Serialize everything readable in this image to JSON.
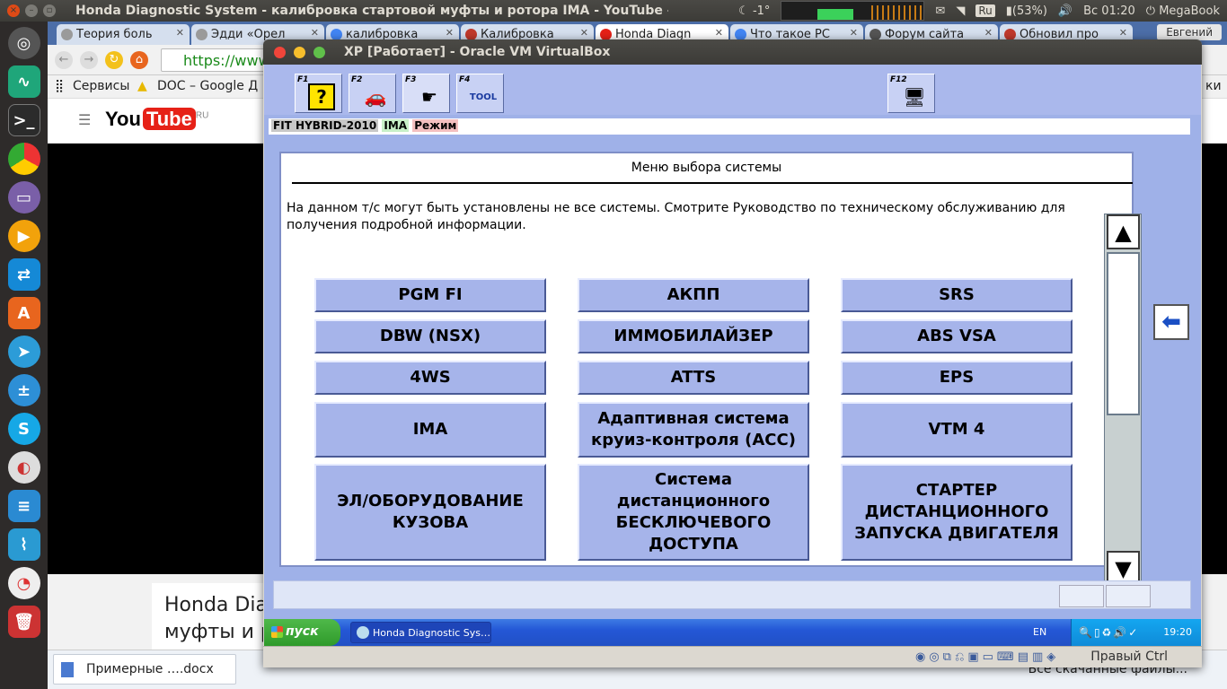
{
  "top_panel": {
    "title": "Honda Diagnostic System - калибровка стартовой муфты и ротора IMA - YouTube - Google",
    "weather": "-1°",
    "keyboard": "Ru",
    "battery": "(53%)",
    "clock": "Вс 01:20",
    "user": "MegaBook"
  },
  "chrome": {
    "tabs": [
      {
        "label": "Теория боль",
        "color": "#9a9a9a"
      },
      {
        "label": "Эдди «Орел",
        "color": "#9a9a9a"
      },
      {
        "label": "калибровка",
        "color": "#4285f4"
      },
      {
        "label": "Калибровка",
        "color": "#c0392b"
      },
      {
        "label": "Honda Diagn",
        "color": "#e62117"
      },
      {
        "label": "Что такое РС",
        "color": "#4285f4"
      },
      {
        "label": "Форум сайта",
        "color": "#555555"
      },
      {
        "label": "Обновил про",
        "color": "#c0392b"
      }
    ],
    "profile": "Евгений",
    "address": "https://www",
    "bookmarks": {
      "apps": "Сервисы",
      "docs": "DOC – Google Д",
      "right": "ки"
    },
    "youtube_region": "RU",
    "video_title": "Honda Dia… муфты и р",
    "download_file": "Примерные ….docx",
    "downloads_all": "Все скачанные файлы..."
  },
  "vbox": {
    "title": "XP [Работает] - Oracle VM VirtualBox",
    "host_key": "Правый Ctrl"
  },
  "hds": {
    "fkeys": [
      {
        "label": "F1",
        "icon": "help-icon"
      },
      {
        "label": "F2",
        "icon": "car-icon"
      },
      {
        "label": "F3",
        "icon": "pgm-sat-icon"
      },
      {
        "label": "F4",
        "icon": "tool-icon"
      },
      {
        "label": "F12",
        "icon": "computer-icon"
      }
    ],
    "vehicle": "FIT HYBRID-2010",
    "system": "IMA",
    "mode": "Режим",
    "panel_title": "Меню выбора системы",
    "note": "На данном т/с могут быть установлены не все системы. Смотрите Руководство по техническому обслуживанию для получения подробной информации.",
    "systems": [
      "PGM FI",
      "АКПП",
      "SRS",
      "DBW (NSX)",
      "ИММОБИЛАЙЗЕР",
      "ABS VSA",
      "4WS",
      "ATTS",
      "EPS",
      "IMA",
      "Адаптивная система круиз-контроля (ACC)",
      "VTM 4",
      "ЭЛ/ОБОРУДОВАНИЕ КУЗОВА",
      "Система дистанционного БЕСКЛЮЧЕВОГО ДОСТУПА",
      "СТАРТЕР ДИСТАНЦИОННОГО ЗАПУСКА ДВИГАТЕЛЯ"
    ],
    "scroll_up": "▲",
    "scroll_down": "▼",
    "back_arrow": "⬅"
  },
  "xp": {
    "start": "пуск",
    "task": "Honda Diagnostic Sys…",
    "lang": "EN",
    "clock": "19:20"
  }
}
